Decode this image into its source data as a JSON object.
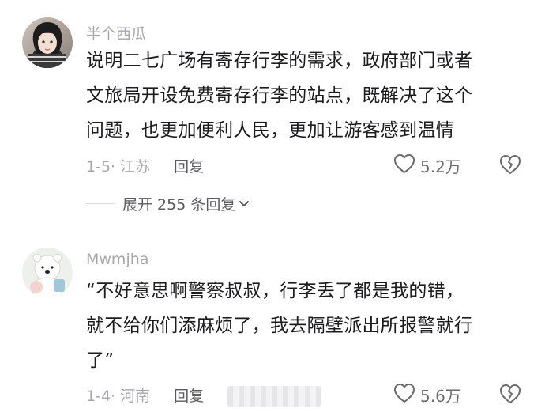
{
  "comments": [
    {
      "username": "半个西瓜",
      "text": "说明二七广场有寄存行李的需求，政府部门或者\n文旅局开设免费寄存行李的站点，既解决了这个\n问题，也更加便利人民，更加让游客感到温情",
      "date_location": "1-5· 江苏",
      "reply_label": "回复",
      "likes": "5.2万"
    },
    {
      "username": "Mwmjha",
      "text": "“不好意思啊警察叔叔，行李丢了都是我的错，\n就不给你们添麻烦了，我去隔壁派出所报警就行\n了”",
      "date_location": "1-4· 河南",
      "reply_label": "回复",
      "likes": "5.6万"
    }
  ],
  "expand_replies_label": "展开 255 条回复",
  "icons": {
    "like": "heart-outline-icon",
    "dislike": "broken-heart-icon",
    "expand": "chevron-down-icon"
  },
  "colors": {
    "text_primary": "#1c1c1e",
    "text_secondary": "#a7a7ad",
    "text_action": "#5a5a5f"
  }
}
